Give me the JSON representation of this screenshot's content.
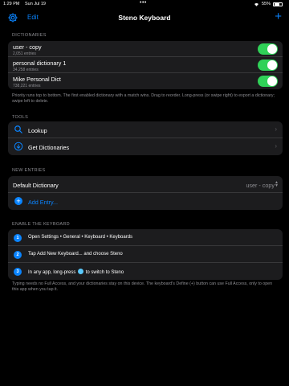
{
  "status_bar": {
    "time": "1:29 PM",
    "date": "Sun Jul 19",
    "dots": "•••",
    "battery": "55%"
  },
  "navbar": {
    "edit_label": "Edit",
    "title": "Steno Keyboard",
    "add_symbol": "+"
  },
  "dictionaries": {
    "header": "DICTIONARIES",
    "items": [
      {
        "name": "user - copy",
        "entries": "2,051 entries",
        "enabled": true
      },
      {
        "name": "personal dictionary 1",
        "entries": "34,258 entries",
        "enabled": true
      },
      {
        "name": "Mike Personal Dict",
        "entries": "738,221 entries",
        "enabled": true
      }
    ],
    "footnote": "Priority runs top to bottom. The first enabled dictionary with a match wins. Drag to reorder. Long-press (or swipe right) to export a dictionary; swipe left to delete."
  },
  "tools": {
    "header": "TOOLS",
    "items": [
      {
        "label": "Lookup",
        "icon": "search-icon"
      },
      {
        "label": "Get Dictionaries",
        "icon": "download-icon"
      }
    ]
  },
  "new_entries": {
    "header": "NEW ENTRIES",
    "default_label": "Default Dictionary",
    "default_value": "user - copy",
    "add_label": "Add Entry..."
  },
  "enable_keyboard": {
    "header": "ENABLE THE KEYBOARD",
    "steps": [
      {
        "num": "1",
        "text": "Open Settings • General • Keyboard • Keyboards"
      },
      {
        "num": "2",
        "text": "Tap Add New Keyboard... and choose Steno"
      },
      {
        "num": "3",
        "text_before": "In any app, long-press",
        "text_after": "to switch to Steno"
      }
    ],
    "footnote": "Typing needs no Full Access, and your dictionaries stay on this device. The keyboard's Define (+) button can use Full Access, only to open this app when you tap it."
  },
  "colors": {
    "accent": "#0a84ff",
    "toggle_on": "#30d158",
    "background": "#000000",
    "card": "#1c1c1e"
  }
}
